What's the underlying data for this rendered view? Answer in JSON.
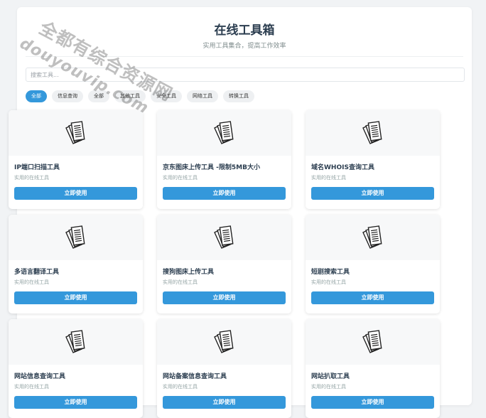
{
  "header": {
    "title": "在线工具箱",
    "subtitle": "实用工具集合，提高工作效率"
  },
  "search": {
    "placeholder": "搜索工具..."
  },
  "filters": [
    "全部",
    "信息查询",
    "全部",
    "其他工具",
    "安全工具",
    "网络工具",
    "转换工具"
  ],
  "active_filter_index": 0,
  "tools": [
    {
      "title": "IP端口扫描工具",
      "desc": "实用的在线工具",
      "button": "立即使用",
      "icon": "documents-icon"
    },
    {
      "title": "京东图床上传工具 -限制5MB大小",
      "desc": "实用的在线工具",
      "button": "立即使用",
      "icon": "documents-icon"
    },
    {
      "title": "域名WHOIS查询工具",
      "desc": "实用的在线工具",
      "button": "立即使用",
      "icon": "documents-icon"
    },
    {
      "title": "多语言翻译工具",
      "desc": "实用的在线工具",
      "button": "立即使用",
      "icon": "documents-icon"
    },
    {
      "title": "搜狗图床上传工具",
      "desc": "实用的在线工具",
      "button": "立即使用",
      "icon": "documents-icon"
    },
    {
      "title": "短剧搜索工具",
      "desc": "实用的在线工具",
      "button": "立即使用",
      "icon": "documents-icon"
    },
    {
      "title": "网站信息查询工具",
      "desc": "实用的在线工具",
      "button": "立即使用",
      "icon": "documents-icon"
    },
    {
      "title": "网站备案信息查询工具",
      "desc": "实用的在线工具",
      "button": "立即使用",
      "icon": "documents-icon"
    },
    {
      "title": "网站扒取工具",
      "desc": "实用的在线工具",
      "button": "立即使用",
      "icon": "documents-icon"
    }
  ],
  "watermark": {
    "line1": "全都有综合资源网",
    "line2": "douyouvip.com"
  },
  "colors": {
    "accent": "#3498db",
    "title": "#2c3e50",
    "muted": "#95a5a6"
  }
}
